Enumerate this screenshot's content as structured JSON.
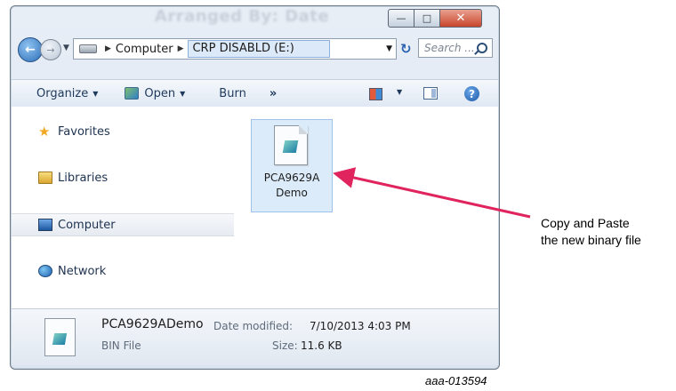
{
  "window": {
    "ghost_title": "Arranged By: Date",
    "buttons": {
      "minimize": "—",
      "maximize": "□",
      "close": "✕"
    }
  },
  "address_bar": {
    "crumbs": [
      "Computer",
      "CRP DISABLD (E:)"
    ],
    "search_placeholder": "Search ..."
  },
  "toolbar": {
    "organize": "Organize",
    "open": "Open",
    "burn": "Burn",
    "more": "»"
  },
  "nav_pane": {
    "items": [
      {
        "label": "Favorites",
        "icon": "star-icon"
      },
      {
        "label": "Libraries",
        "icon": "libraries-icon"
      },
      {
        "label": "Computer",
        "icon": "computer-icon",
        "selected": true
      },
      {
        "label": "Network",
        "icon": "network-icon"
      }
    ]
  },
  "file": {
    "name_line1": "PCA9629A",
    "name_line2": "Demo",
    "icon": "bin-file-icon"
  },
  "details": {
    "name": "PCA9629ADemo",
    "type": "BIN File",
    "modified_label": "Date modified:",
    "modified_value": "7/10/2013 4:03 PM",
    "size_label": "Size:",
    "size_value": "11.6 KB"
  },
  "annotation": {
    "line1": "Copy and Paste",
    "line2": "the new binary file",
    "arrow_color": "#e0245e"
  },
  "figure_id": "aaa-013594"
}
